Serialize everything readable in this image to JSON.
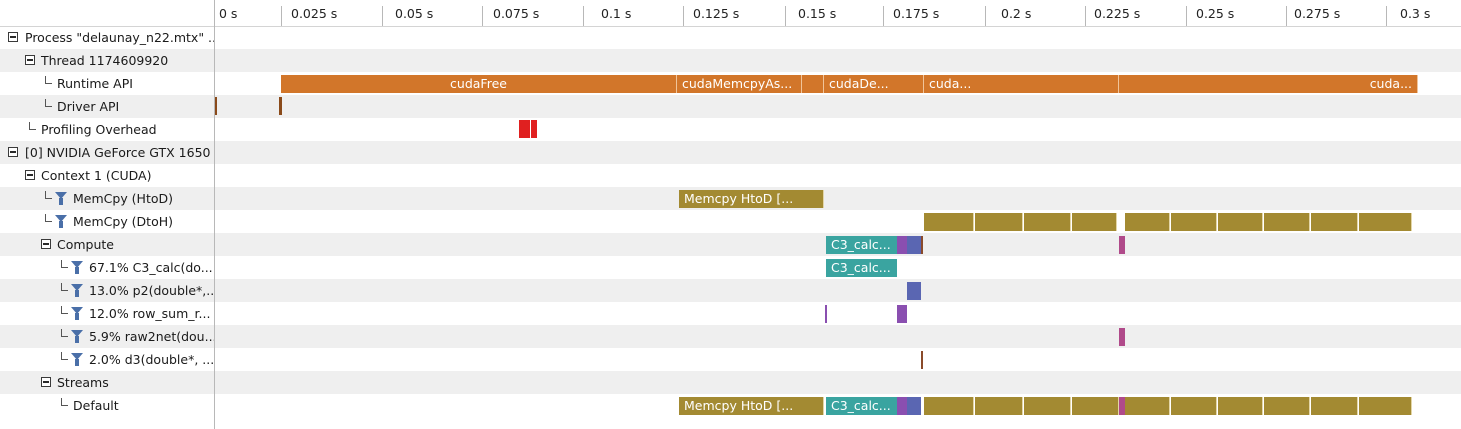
{
  "ruler": {
    "ticks": [
      "0 s",
      "0.025 s",
      "0.05 s",
      "0.075 s",
      "0.1 s",
      "0.125 s",
      "0.15 s",
      "0.175 s",
      "0.2 s",
      "0.225 s",
      "0.25 s",
      "0.275 s",
      "0.3 s"
    ]
  },
  "tree": {
    "process": "Process \"delaunay_n22.mtx\" ...",
    "thread": "Thread 1174609920",
    "runtime_api": "Runtime API",
    "driver_api": "Driver API",
    "profiling_overhead": "Profiling Overhead",
    "gpu": "[0] NVIDIA GeForce GTX 1650",
    "context": "Context 1 (CUDA)",
    "memcpy_htod": "MemCpy (HtoD)",
    "memcpy_dtoh": "MemCpy (DtoH)",
    "compute": "Compute",
    "kernel1": "67.1% C3_calc(do...",
    "kernel2": "13.0% p2(double*,...",
    "kernel3": "12.0% row_sum_r...",
    "kernel4": "5.9% raw2net(dou...",
    "kernel5": "2.0% d3(double*, ...",
    "streams": "Streams",
    "default": "Default"
  },
  "bars": {
    "cudaFree": "cudaFree",
    "cudaMemcpyAsync": "cudaMemcpyAs...",
    "cudaDe": "cudaDe...",
    "cuda1": "cuda...",
    "cuda2": "cuda...",
    "memcpy_htod": "Memcpy HtoD [...",
    "c3_calc": "C3_calc...",
    "c3_calc_short": "C3_calc..."
  },
  "colors": {
    "runtime": "#d2762a",
    "memcpy": "#a38a32",
    "kernel_teal": "#3aa4a0",
    "kernel_blue": "#5a66b2",
    "kernel_purple": "#8a4fb0",
    "overhead": "#e02020"
  }
}
